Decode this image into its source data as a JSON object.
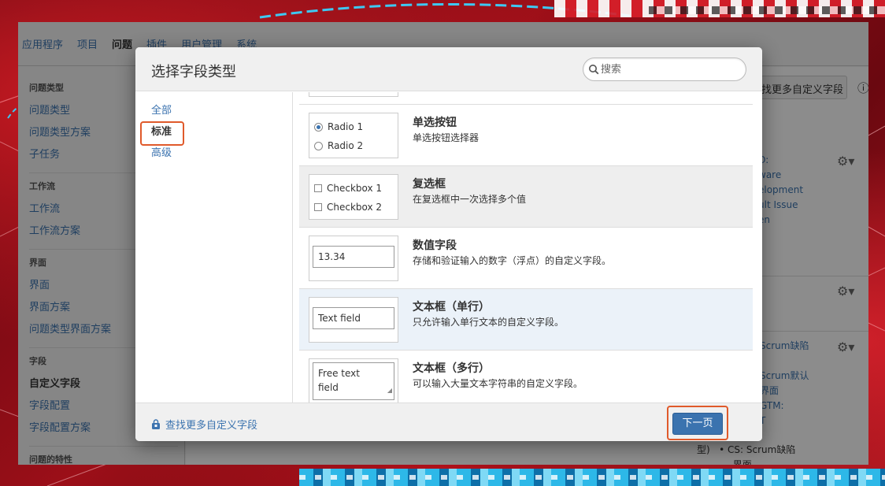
{
  "topnav": {
    "items": [
      "应用程序",
      "项目",
      "问题",
      "插件",
      "用户管理",
      "系统"
    ],
    "active": "问题"
  },
  "sidebar": {
    "groups": [
      {
        "title": "问题类型",
        "items": [
          "问题类型",
          "问题类型方案",
          "子任务"
        ]
      },
      {
        "title": "工作流",
        "items": [
          "工作流",
          "工作流方案"
        ]
      },
      {
        "title": "界面",
        "items": [
          "界面",
          "界面方案",
          "问题类型界面方案"
        ]
      },
      {
        "title": "字段",
        "items": [
          "自定义字段",
          "字段配置",
          "字段配置方案"
        ]
      },
      {
        "title": "问题的特性",
        "items": []
      }
    ],
    "active": "自定义字段"
  },
  "background": {
    "find_more_button": "找更多自定义字段",
    "help_icon": "help-icon",
    "text1": "O:\nware\nelopment\nult Issue\nen",
    "text2": "Scrum缺陷",
    "text3": "Scrum默认\n界面\nGTM:\nT",
    "text4": "型)   • CS: Scrum缺陷\n            界面"
  },
  "dialog": {
    "title": "选择字段类型",
    "search_placeholder": "搜索",
    "nav": [
      {
        "label": "全部"
      },
      {
        "label": "标准"
      },
      {
        "label": "高级"
      }
    ],
    "nav_active": "标准",
    "fields": [
      {
        "name": "单选按钮",
        "desc": "单选按钮选择器",
        "preview": [
          "Radio 1",
          "Radio 2"
        ]
      },
      {
        "name": "复选框",
        "desc": "在复选框中一次选择多个值",
        "preview": [
          "Checkbox 1",
          "Checkbox 2"
        ]
      },
      {
        "name": "数值字段",
        "desc": "存储和验证输入的数字（浮点）的自定义字段。",
        "preview": "13.34"
      },
      {
        "name": "文本框（单行）",
        "desc": "只允许输入单行文本的自定义字段。",
        "preview": "Text field"
      },
      {
        "name": "文本框（多行）",
        "desc": "可以输入大量文本字符串的自定义字段。",
        "preview": "Free text\nfield"
      }
    ],
    "footer_link": "查找更多自定义字段",
    "next_button": "下一页"
  },
  "colors": {
    "link": "#3b73af",
    "primary_button": "#3b73af",
    "highlight_border": "#e05a2b",
    "selected_row": "#ebf2f9"
  }
}
